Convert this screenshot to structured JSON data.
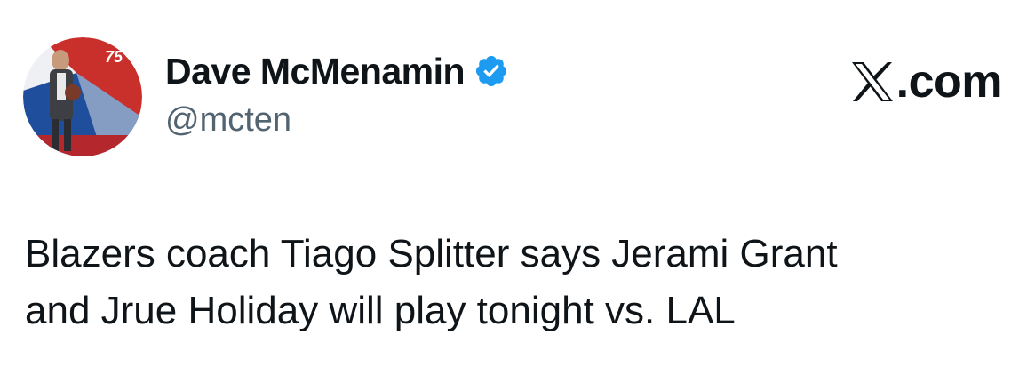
{
  "author": {
    "display_name": "Dave McMenamin",
    "handle": "@mcten",
    "verified": true,
    "avatar_icon": "profile-photo-avatar",
    "badge_icon": "verified-badge-icon",
    "badge_color": "#1d9bf0"
  },
  "brand": {
    "text": ".com",
    "logo_icon": "x-logo-icon",
    "color": "#0f1419"
  },
  "tweet": {
    "lines": [
      "Blazers coach Tiago Splitter says Jerami Grant",
      "and Jrue Holiday will play tonight vs. LAL"
    ]
  },
  "colors": {
    "text_primary": "#0f1419",
    "text_secondary": "#536471",
    "background": "#ffffff"
  }
}
